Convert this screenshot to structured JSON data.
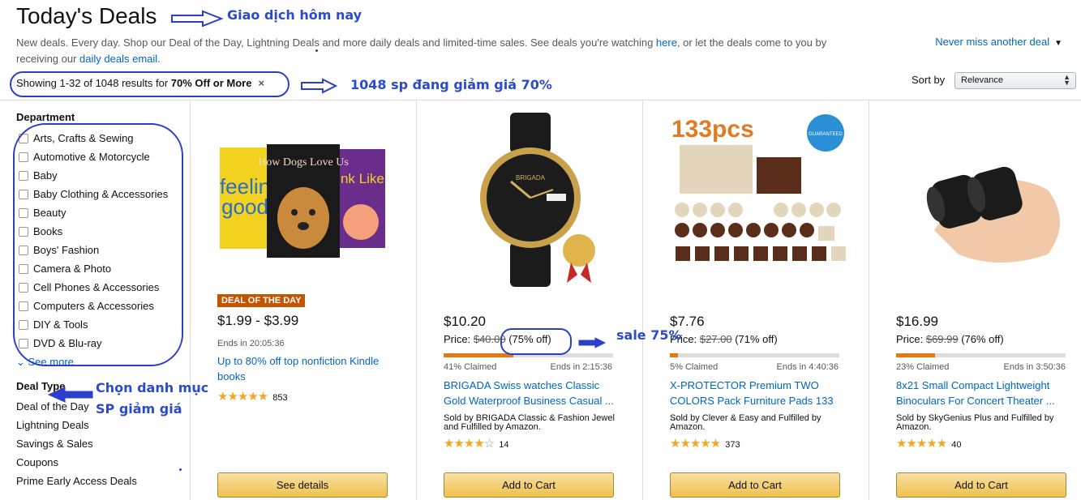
{
  "header": {
    "title": "Today's Deals",
    "subtitle_a": "New deals. Every day. Shop our Deal of the Day, Lightning Deals and more daily deals and limited-time sales. See deals you're watching ",
    "subtitle_here": "here",
    "subtitle_b": ", or let the deals come to you by receiving our ",
    "subtitle_email": "daily deals email",
    "subtitle_c": ".",
    "never_miss": "Never miss another deal"
  },
  "results": {
    "prefix": "Showing 1-32 of 1048 results for ",
    "filter": "70% Off or More",
    "clear": "×"
  },
  "sort": {
    "label": "Sort by",
    "selected": "Relevance"
  },
  "sidebar": {
    "department_title": "Department",
    "departments": [
      "Arts, Crafts & Sewing",
      "Automotive & Motorcycle",
      "Baby",
      "Baby Clothing & Accessories",
      "Beauty",
      "Books",
      "Boys' Fashion",
      "Camera & Photo",
      "Cell Phones & Accessories",
      "Computers & Accessories",
      "DIY & Tools",
      "DVD & Blu-ray"
    ],
    "see_more": "See more",
    "deal_type_title": "Deal Type",
    "deal_types": [
      "Deal of the Day",
      "Lightning Deals",
      "Savings & Sales",
      "Coupons",
      "Prime Early Access Deals"
    ]
  },
  "cards": [
    {
      "badge": "DEAL OF THE DAY",
      "price": "$1.99 - $3.99",
      "ends": "Ends in 20:05:36",
      "title": "Up to 80% off top nonfiction Kindle books",
      "stars": 4.5,
      "stars_text": "★★★★★",
      "reviews": "853",
      "button": "See details",
      "img_text": "How Dogs Love Us"
    },
    {
      "price": "$10.20",
      "price_prefix": "Price: ",
      "old_price": "$40.00",
      "off": " (75% off)",
      "claimed_pct": 41,
      "claimed": "41% Claimed",
      "ends": "Ends in 2:15:36",
      "title": "BRIGADA Swiss watches Classic Gold Waterproof Business Casual ...",
      "sold_by": "Sold by BRIGADA Classic & Fashion Jewel and Fulfilled by Amazon.",
      "stars": 4,
      "stars_text": "★★★★",
      "stars_empty": "☆",
      "reviews": "14",
      "button": "Add to Cart",
      "img_text": "BRIGADA"
    },
    {
      "price": "$7.76",
      "price_prefix": "Price: ",
      "old_price": "$27.00",
      "off": " (71% off)",
      "claimed_pct": 5,
      "claimed": "5% Claimed",
      "ends": "Ends in 4:40:36",
      "title": "X-PROTECTOR Premium TWO COLORS Pack Furniture Pads 133 ...",
      "sold_by": "Sold by Clever & Easy and Fulfilled by Amazon.",
      "stars": 4.5,
      "stars_text": "★★★★★",
      "reviews": "373",
      "button": "Add to Cart",
      "img_text": "133pcs",
      "img_badge": "QUALITY GUARANTEED 100%"
    },
    {
      "price": "$16.99",
      "price_prefix": "Price: ",
      "old_price": "$69.99",
      "off": " (76% off)",
      "claimed_pct": 23,
      "claimed": "23% Claimed",
      "ends": "Ends in 3:50:36",
      "title": "8x21 Small Compact Lightweight Binoculars For Concert Theater ...",
      "sold_by": "Sold by SkyGenius Plus and Fulfilled by Amazon.",
      "stars": 5,
      "stars_text": "★★★★★",
      "reviews": "40",
      "button": "Add to Cart",
      "img_text": ""
    }
  ],
  "annotations": {
    "title_note": "Giao dịch hôm nay",
    "results_note": "1048 sp đang giảm giá 70%",
    "sale_note": "sale 75%",
    "category_note_1": "Chọn danh mục",
    "category_note_2": "SP giảm giá"
  },
  "colors": {
    "link": "#0066c0",
    "badge": "#c45500",
    "claim_bar": "#e47911",
    "annotation": "#2b4bcf"
  }
}
